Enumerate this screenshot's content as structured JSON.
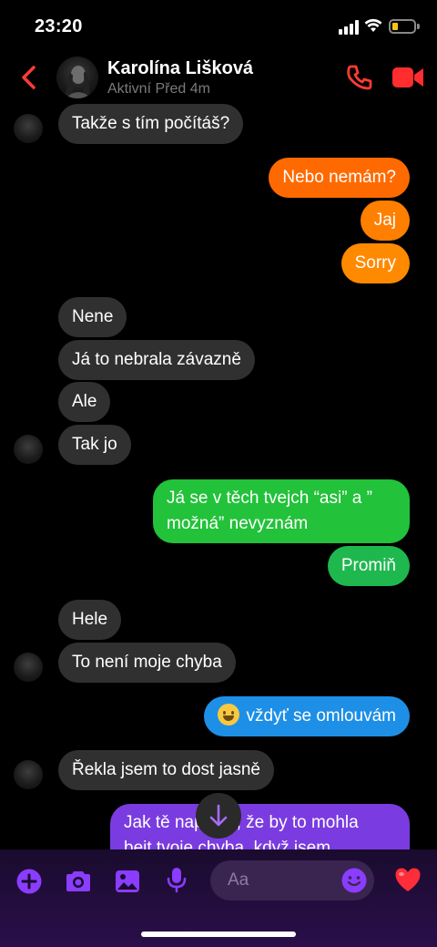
{
  "status_bar": {
    "time": "23:20"
  },
  "header": {
    "contact_name": "Karolína Lišková",
    "contact_status": "Aktivní Před 4m"
  },
  "messages": [
    {
      "side": "in",
      "text": "Takže s tím počítáš?"
    },
    {
      "side": "out",
      "text": "Nebo nemám?",
      "color": "#ff6a00"
    },
    {
      "side": "out",
      "text": "Jaj",
      "color": "#ff7f00"
    },
    {
      "side": "out",
      "text": "Sorry",
      "color": "#ff8a00"
    },
    {
      "side": "in",
      "text": "Nene"
    },
    {
      "side": "in",
      "text": "Já to nebrala závazně"
    },
    {
      "side": "in",
      "text": "Ale"
    },
    {
      "side": "in",
      "text": "Tak jo"
    },
    {
      "side": "out",
      "line1": "Já se v těch tvejch “asi” a ”",
      "line2": "možná” nevyznám",
      "color": "#22c23a"
    },
    {
      "side": "out",
      "text": "Promiň",
      "color": "#1fb84f"
    },
    {
      "side": "in",
      "text": "Hele"
    },
    {
      "side": "in",
      "text": "To není moje chyba"
    },
    {
      "side": "out",
      "text": "vždyť se omlouvám",
      "color": "#1e8fe6",
      "emoji": "grinning-face"
    },
    {
      "side": "in",
      "text": "Řekla jsem to dost jasně"
    },
    {
      "side": "out",
      "line1": "Jak tě napadlo, že by to mohla",
      "line2": "bejt tvoje chyba, když jsem",
      "color": "#7a3ce0"
    }
  ],
  "composer": {
    "placeholder": "Aa",
    "icons": [
      "plus-icon",
      "camera-icon",
      "gallery-icon",
      "microphone-icon",
      "emoji-icon",
      "heart-icon"
    ],
    "accent": "#8a3cff"
  },
  "colors": {
    "incoming_bubble": "#303030",
    "header_accent": "#ff3b30"
  }
}
